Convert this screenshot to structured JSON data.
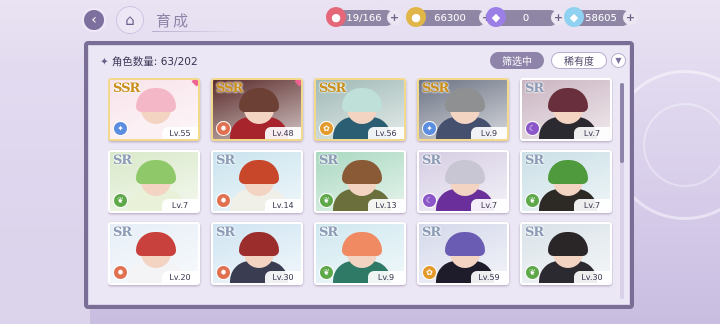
{
  "header": {
    "title": "育成",
    "back_icon": "chevron-left-icon",
    "home_icon": "castle-icon"
  },
  "resources": [
    {
      "icon": "candy-icon",
      "value": "19/166"
    },
    {
      "icon": "gold-coin-icon",
      "value": "66300"
    },
    {
      "icon": "gem-purple-icon",
      "value": "0"
    },
    {
      "icon": "diamond-blue-icon",
      "value": "58605"
    }
  ],
  "panel": {
    "count_label": "角色数量: 63/202",
    "filter_label": "筛选中",
    "rarity_label": "稀有度",
    "sort_icon": "sort-toggle-icon"
  },
  "characters": [
    {
      "rarity": "SSR",
      "level": "Lv.55",
      "element": "wind",
      "element_color": "#5b8ee0",
      "new": true,
      "hair": "#f3b7c7",
      "outfit": "#fbf0f4",
      "bg": "#f8e3ea"
    },
    {
      "rarity": "SSR",
      "level": "Lv.48",
      "element": "fire",
      "element_color": "#e0704f",
      "new": true,
      "hair": "#6d4036",
      "outfit": "#a8242c",
      "bg": "#5a2b2a"
    },
    {
      "rarity": "SSR",
      "level": "Lv.56",
      "element": "earth",
      "element_color": "#e39a2b",
      "new": false,
      "hair": "#bfe0d8",
      "outfit": "#2b5e72",
      "bg": "#9fb9b5"
    },
    {
      "rarity": "SSR",
      "level": "Lv.9",
      "element": "wind",
      "element_color": "#5b8ee0",
      "new": false,
      "hair": "#8e9091",
      "outfit": "#44506e",
      "bg": "#6c7384"
    },
    {
      "rarity": "SR",
      "level": "Lv.7",
      "element": "dark",
      "element_color": "#8a56c9",
      "new": false,
      "hair": "#6a2f3c",
      "outfit": "#2b2a31",
      "bg": "#c9b3c0"
    },
    {
      "rarity": "SR",
      "level": "Lv.7",
      "element": "nature",
      "element_color": "#5ea84a",
      "new": false,
      "hair": "#8fc868",
      "outfit": "#e9f1d9",
      "bg": "#d8e8c8"
    },
    {
      "rarity": "SR",
      "level": "Lv.14",
      "element": "fire",
      "element_color": "#e0704f",
      "new": false,
      "hair": "#c8462a",
      "outfit": "#f0efe8",
      "bg": "#c9e3ee"
    },
    {
      "rarity": "SR",
      "level": "Lv.13",
      "element": "nature",
      "element_color": "#5ea84a",
      "new": false,
      "hair": "#8a5a36",
      "outfit": "#6a6f3c",
      "bg": "#a9d8c0"
    },
    {
      "rarity": "SR",
      "level": "Lv.7",
      "element": "dark",
      "element_color": "#8a56c9",
      "new": false,
      "hair": "#c9c6d4",
      "outfit": "#6a2f9a",
      "bg": "#d5cde3"
    },
    {
      "rarity": "SR",
      "level": "Lv.7",
      "element": "nature",
      "element_color": "#5ea84a",
      "new": false,
      "hair": "#4f9a3c",
      "outfit": "#2d2a26",
      "bg": "#c9dfe6"
    },
    {
      "rarity": "SR",
      "level": "Lv.20",
      "element": "fire",
      "element_color": "#e0704f",
      "new": false,
      "hair": "#c9413d",
      "outfit": "#f4f4f6",
      "bg": "#e6eef6"
    },
    {
      "rarity": "SR",
      "level": "Lv.30",
      "element": "fire",
      "element_color": "#e0704f",
      "new": false,
      "hair": "#9b2e2c",
      "outfit": "#3a3d52",
      "bg": "#cfe4f2"
    },
    {
      "rarity": "SR",
      "level": "Lv.9",
      "element": "nature",
      "element_color": "#5ea84a",
      "new": false,
      "hair": "#f08a62",
      "outfit": "#2f7a66",
      "bg": "#cfe8ef"
    },
    {
      "rarity": "SR",
      "level": "Lv.59",
      "element": "earth",
      "element_color": "#e39a2b",
      "new": false,
      "hair": "#6a5cb3",
      "outfit": "#1e1c2a",
      "bg": "#d4d8ea"
    },
    {
      "rarity": "SR",
      "level": "Lv.30",
      "element": "nature",
      "element_color": "#5ea84a",
      "new": false,
      "hair": "#2a2628",
      "outfit": "#2b2a30",
      "bg": "#d9e2e8"
    }
  ]
}
